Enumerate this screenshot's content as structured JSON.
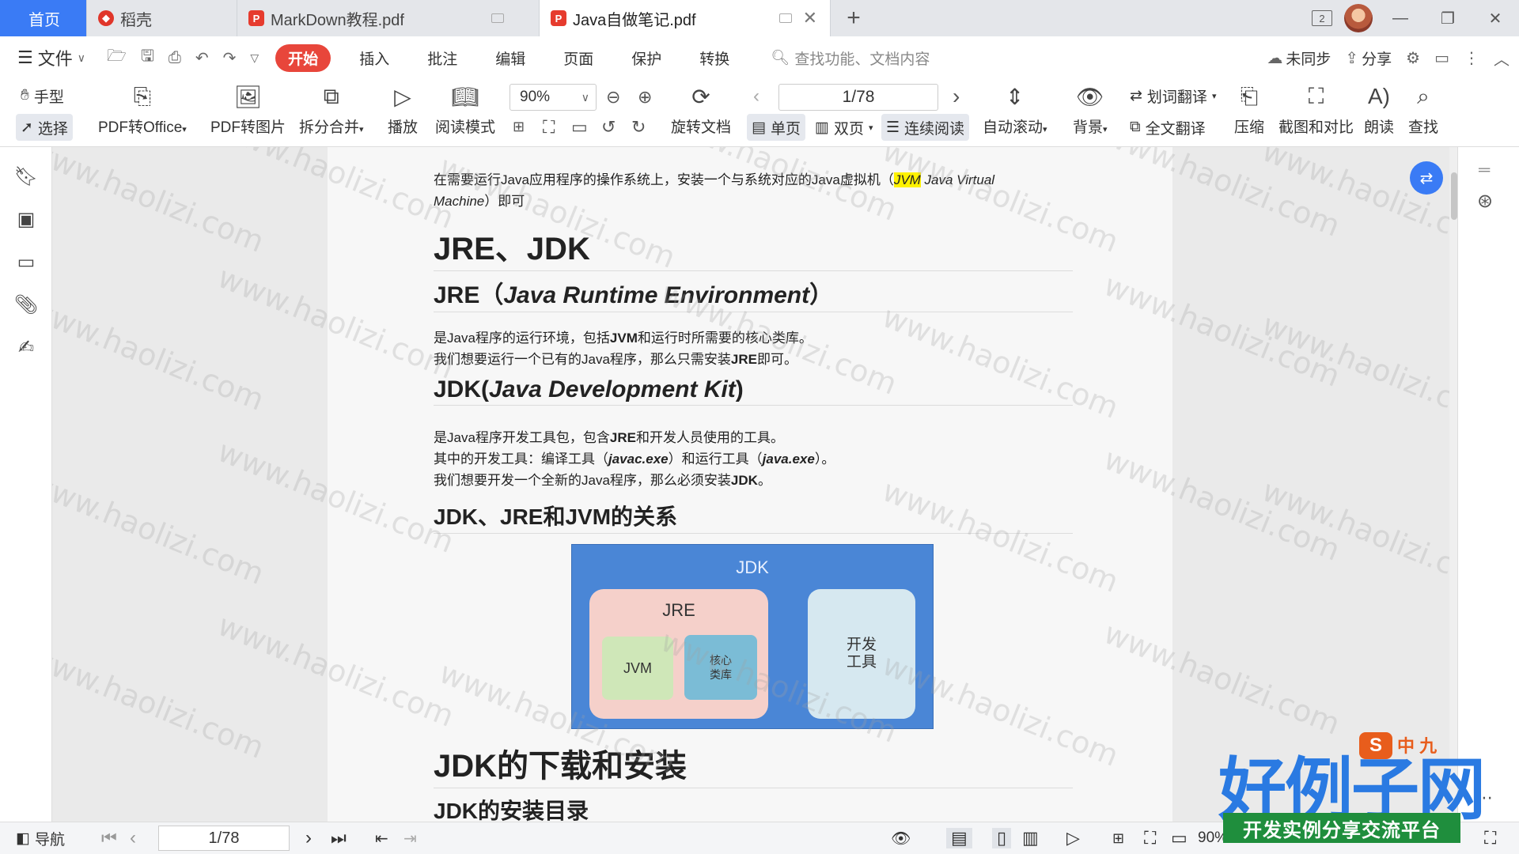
{
  "tabs": {
    "home": "首页",
    "daoke": "稻壳",
    "markdown": "MarkDown教程.pdf",
    "java": "Java自做笔记.pdf"
  },
  "window": {
    "window_count": "2"
  },
  "menu": {
    "file": "文件",
    "start": "开始",
    "insert": "插入",
    "annotate": "批注",
    "edit": "编辑",
    "page": "页面",
    "protect": "保护",
    "convert": "转换",
    "search_placeholder": "查找功能、文档内容",
    "sync": "未同步",
    "share": "分享"
  },
  "ribbon": {
    "hand": "手型",
    "select": "选择",
    "pdf_to_office": "PDF转Office",
    "pdf_to_image": "PDF转图片",
    "split_merge": "拆分合并",
    "play": "播放",
    "read_mode": "阅读模式",
    "zoom": "90%",
    "rotate_doc": "旋转文档",
    "page_indicator": "1/78",
    "single_page": "单页",
    "double_page": "双页",
    "continuous_read": "连续阅读",
    "auto_scroll": "自动滚动",
    "background": "背景",
    "word_translate": "划词翻译",
    "full_translate": "全文翻译",
    "compress": "压缩",
    "screenshot_compare": "截图和对比",
    "read_aloud": "朗读",
    "find": "查找"
  },
  "document": {
    "intro_line1": "在需要运行Java应用程序的操作系统上，安装一个与系统对应的Java虚拟机（",
    "intro_hl": "JVM",
    "intro_tail": " Java Virtual",
    "intro_line2_it": "Machine",
    "intro_line2_rest": "）即可",
    "h_jre_jdk": "JRE、JDK",
    "h_jre_prefix": "JRE（",
    "h_jre_it": "Java Runtime Environment",
    "h_jre_suffix": "）",
    "jre_p1_a": "是Java程序的运行环境，包括",
    "jre_p1_b": "JVM",
    "jre_p1_c": "和运行时所需要的核心类库。",
    "jre_p2_a": "我们想要运行一个已有的Java程序，那么只需安装",
    "jre_p2_b": "JRE",
    "jre_p2_c": "即可。",
    "h_jdk_prefix": "JDK(",
    "h_jdk_it": "Java Development Kit",
    "h_jdk_suffix": ")",
    "jdk_p1_a": "是Java程序开发工具包，包含",
    "jdk_p1_b": "JRE",
    "jdk_p1_c": "和开发人员使用的工具。",
    "jdk_p2_a": "其中的开发工具：编译工具（",
    "jdk_p2_b": "javac.exe",
    "jdk_p2_c": "）和运行工具（",
    "jdk_p2_d": "java.exe",
    "jdk_p2_e": "）。",
    "jdk_p3_a": "我们想要开发一个全新的Java程序，那么必须安装",
    "jdk_p3_b": "JDK",
    "jdk_p3_c": "。",
    "h_relation": "JDK、JRE和JVM的关系",
    "h_download": "JDK的下载和安装",
    "h_install_dir": "JDK的安装目录"
  },
  "diagram": {
    "jdk": "JDK",
    "jre": "JRE",
    "jvm": "JVM",
    "core_lib_1": "核心",
    "core_lib_2": "类库",
    "dev_tools_1": "开发",
    "dev_tools_2": "工具"
  },
  "statusbar": {
    "nav": "导航",
    "page": "1/78",
    "zoom": "90%"
  },
  "watermark": "www.haolizi.com",
  "brand": {
    "title": "好例子网",
    "subtitle": "开发实例分享交流平台",
    "logo_letter": "S",
    "logo_text": "中 九"
  }
}
